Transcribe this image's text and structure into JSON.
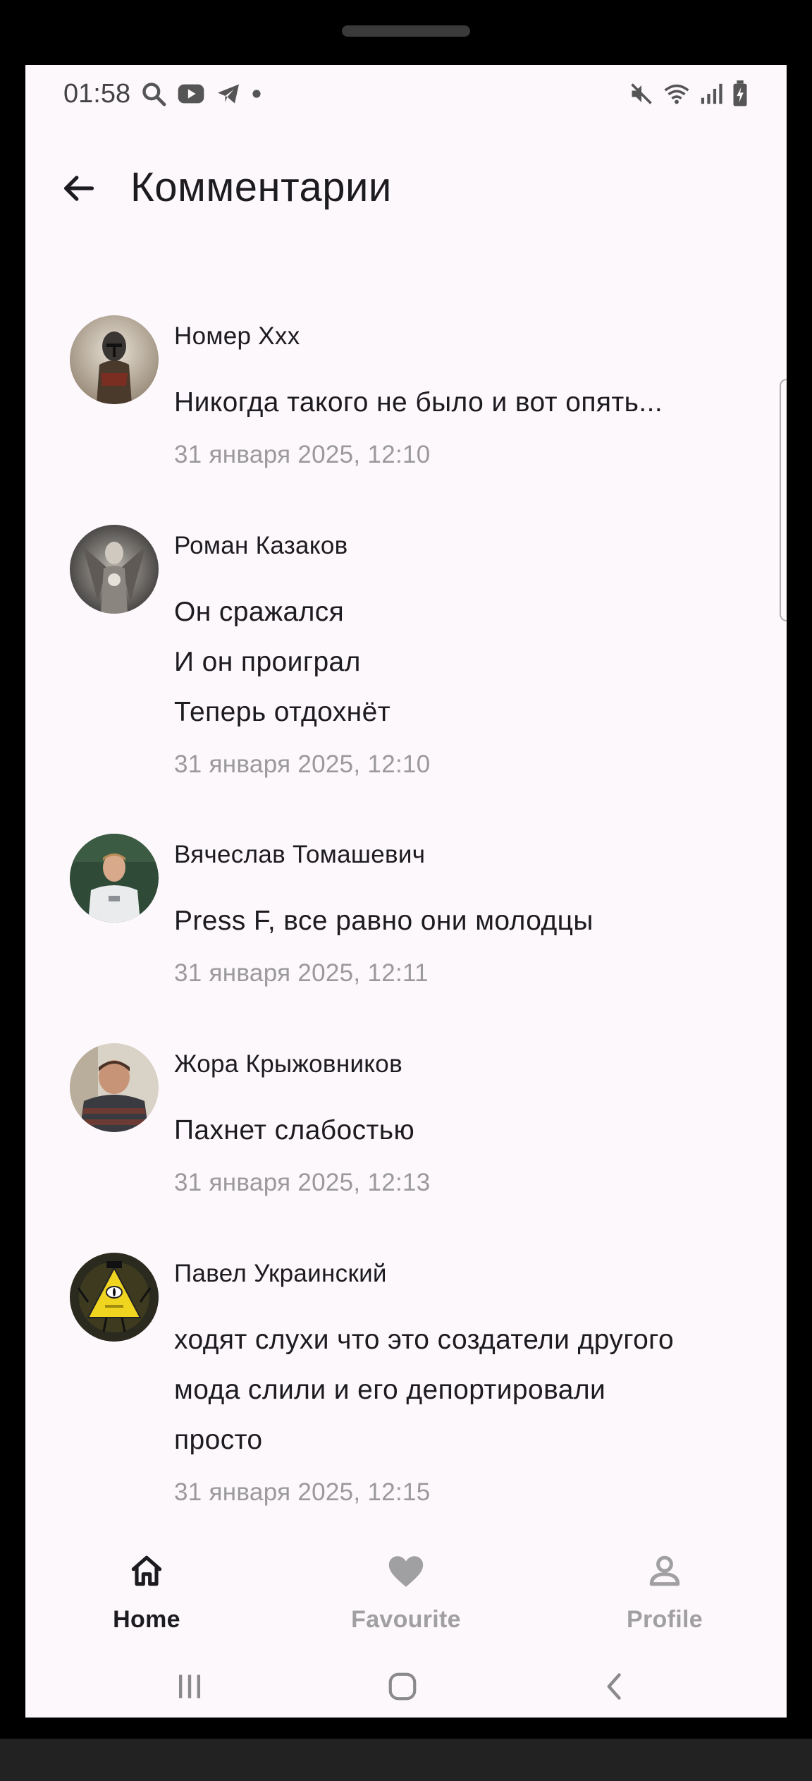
{
  "status_bar": {
    "time": "01:58"
  },
  "header": {
    "title": "Комментарии"
  },
  "comments": [
    {
      "author": "Номер Ххх",
      "lines": [
        "Никогда такого не было и вот опять..."
      ],
      "date": "31 января 2025, 12:10"
    },
    {
      "author": "Роман Казаков",
      "lines": [
        "Он сражался",
        "И он проиграл",
        "Теперь отдохнёт"
      ],
      "date": "31 января 2025, 12:10"
    },
    {
      "author": "Вячеслав Томашевич",
      "lines": [
        "Press F, все равно они молодцы"
      ],
      "date": "31 января 2025, 12:11"
    },
    {
      "author": "Жора Крыжовников",
      "lines": [
        "Пахнет слабостью"
      ],
      "date": "31 января 2025, 12:13"
    },
    {
      "author": "Павел Украинский",
      "lines": [
        "ходят слухи что это создатели другого",
        "мода слили и его депортировали",
        "просто"
      ],
      "date": "31 января 2025, 12:15"
    }
  ],
  "bottom_nav": {
    "items": [
      {
        "label": "Home",
        "icon": "home-icon",
        "active": true
      },
      {
        "label": "Favourite",
        "icon": "heart-icon",
        "active": false
      },
      {
        "label": "Profile",
        "icon": "person-icon",
        "active": false
      }
    ],
    "active_color": "#1c1b1f",
    "inactive_color": "#a09fa2"
  }
}
